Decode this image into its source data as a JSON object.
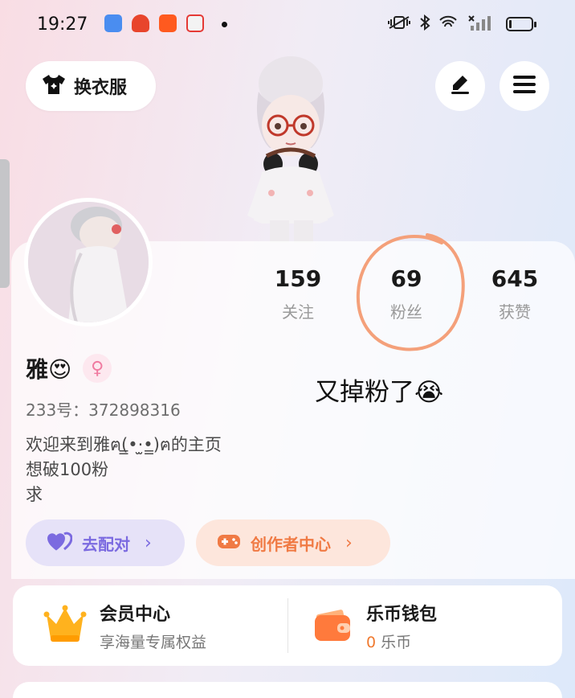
{
  "status_bar": {
    "time": "19:27",
    "notification_icons": [
      "app-blue-icon",
      "app-red-icon",
      "app-taobao-icon",
      "app-dog-icon"
    ],
    "right_icons": [
      "vibrate-icon",
      "bluetooth-icon",
      "wifi-icon",
      "signal-icon",
      "battery-icon"
    ]
  },
  "header": {
    "outfit_button_label": "换衣服",
    "outfit_icon": "tshirt-icon",
    "edit_icon": "pen-icon",
    "menu_icon": "hamburger-menu-icon"
  },
  "stats": [
    {
      "value": "159",
      "label": "关注"
    },
    {
      "value": "69",
      "label": "粉丝"
    },
    {
      "value": "645",
      "label": "获赞"
    }
  ],
  "profile": {
    "name": "雅😍",
    "gender_symbol": "♀",
    "uid": "233号：372898316",
    "bio": [
      "欢迎来到雅ฅ(̳•·̫•̳)ฅ的主页",
      "想破100粉",
      "求"
    ]
  },
  "annotation": {
    "text": "又掉粉了😭",
    "circle_color": "#f4a07a"
  },
  "actions": {
    "match_label": "去配对",
    "match_icon": "heart-icon",
    "creator_label": "创作者中心",
    "creator_icon": "gamepad-icon",
    "chevron": "›"
  },
  "bottom_card": {
    "vip_title": "会员中心",
    "vip_subtitle": "享海量专属权益",
    "vip_icon": "crown-icon",
    "wallet_title": "乐币钱包",
    "wallet_amount": "0",
    "wallet_unit": " 乐币",
    "wallet_icon": "wallet-icon"
  },
  "colors": {
    "accent_purple": "#7b6ae0",
    "accent_orange": "#f07a44",
    "coin_orange": "#f07a30"
  }
}
